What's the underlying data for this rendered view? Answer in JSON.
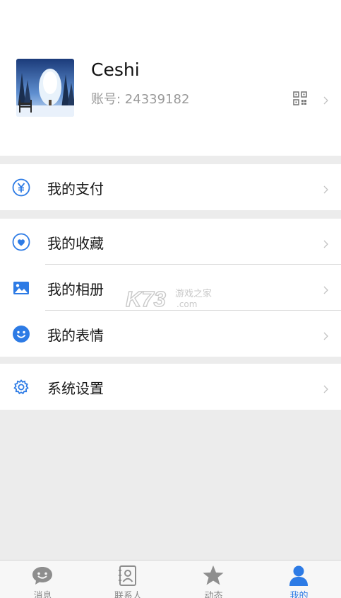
{
  "profile": {
    "name": "Ceshi",
    "account": "账号: 24339182",
    "avatar_icon": "winter-tree-avatar",
    "qr_icon": "qr-code-icon"
  },
  "menu": {
    "groups": [
      {
        "items": [
          {
            "label": "我的支付",
            "icon": "yen-icon"
          }
        ]
      },
      {
        "items": [
          {
            "label": "我的收藏",
            "icon": "heart-icon"
          },
          {
            "label": "我的相册",
            "icon": "photo-icon"
          },
          {
            "label": "我的表情",
            "icon": "smiley-icon"
          }
        ]
      },
      {
        "items": [
          {
            "label": "系统设置",
            "icon": "gear-icon"
          }
        ]
      }
    ]
  },
  "watermark": {
    "brand": "K73",
    "text": "游戏之家",
    "domain": ".com"
  },
  "tabbar": {
    "tabs": [
      {
        "label": "消息",
        "icon": "chat-bubble-icon",
        "active": false
      },
      {
        "label": "联系人",
        "icon": "contacts-icon",
        "active": false
      },
      {
        "label": "动态",
        "icon": "star-icon",
        "active": false
      },
      {
        "label": "我的",
        "icon": "person-icon",
        "active": true
      }
    ]
  },
  "colors": {
    "accent": "#2d7be5",
    "inactive": "#8a8a8a",
    "background": "#ececec"
  }
}
